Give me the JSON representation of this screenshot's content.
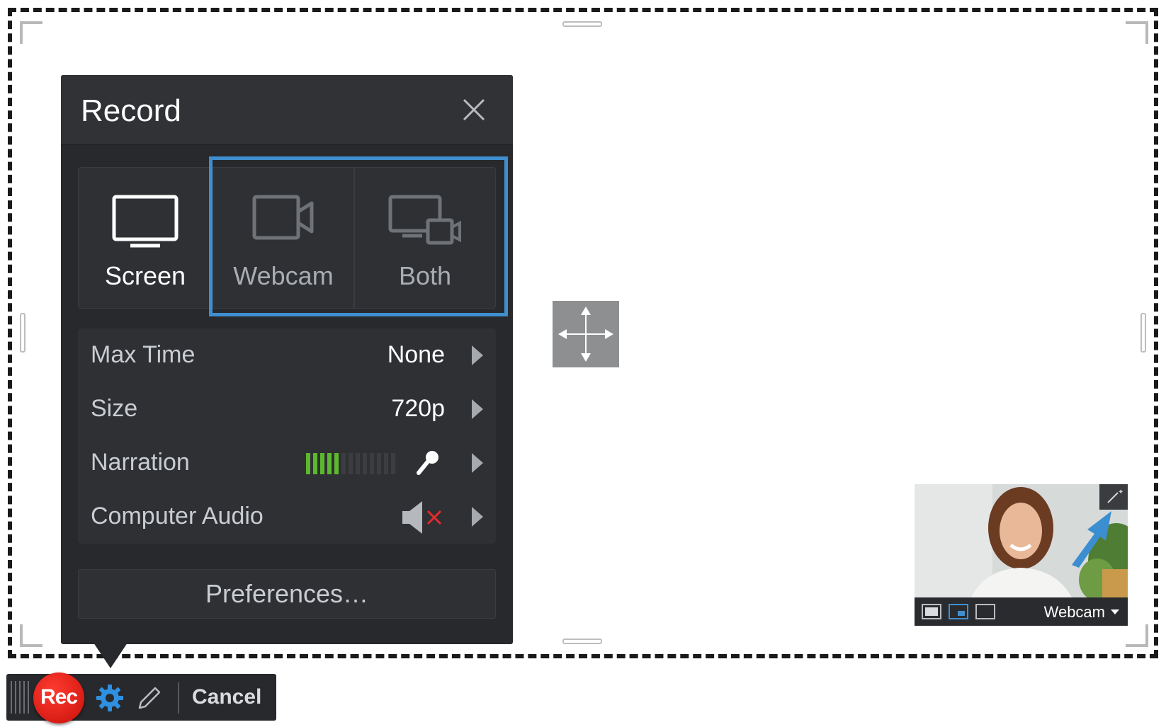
{
  "panel": {
    "title": "Record",
    "modes": [
      {
        "label": "Screen",
        "icon": "monitor-icon",
        "selected": true
      },
      {
        "label": "Webcam",
        "icon": "webcam-icon",
        "selected": false
      },
      {
        "label": "Both",
        "icon": "screen-and-webcam-icon",
        "selected": false
      }
    ],
    "settings": [
      {
        "label": "Max Time",
        "value": "None"
      },
      {
        "label": "Size",
        "value": "720p"
      },
      {
        "label": "Narration",
        "level_filled": 5,
        "level_total": 13,
        "icon": "microphone-icon"
      },
      {
        "label": "Computer Audio",
        "icon": "speaker-muted-icon"
      }
    ],
    "preferences_label": "Preferences…"
  },
  "webcam_preview": {
    "source_label": "Webcam",
    "icon_enhance": "magic-wand-icon"
  },
  "toolbar": {
    "rec_label": "Rec",
    "cancel_label": "Cancel"
  },
  "colors": {
    "panel_bg": "#27292d",
    "highlight": "#3f8fd0",
    "rec": "#e1140c",
    "level_on": "#5cb82c",
    "muted_x": "#e52a2a",
    "accent": "#2f8fe0"
  }
}
